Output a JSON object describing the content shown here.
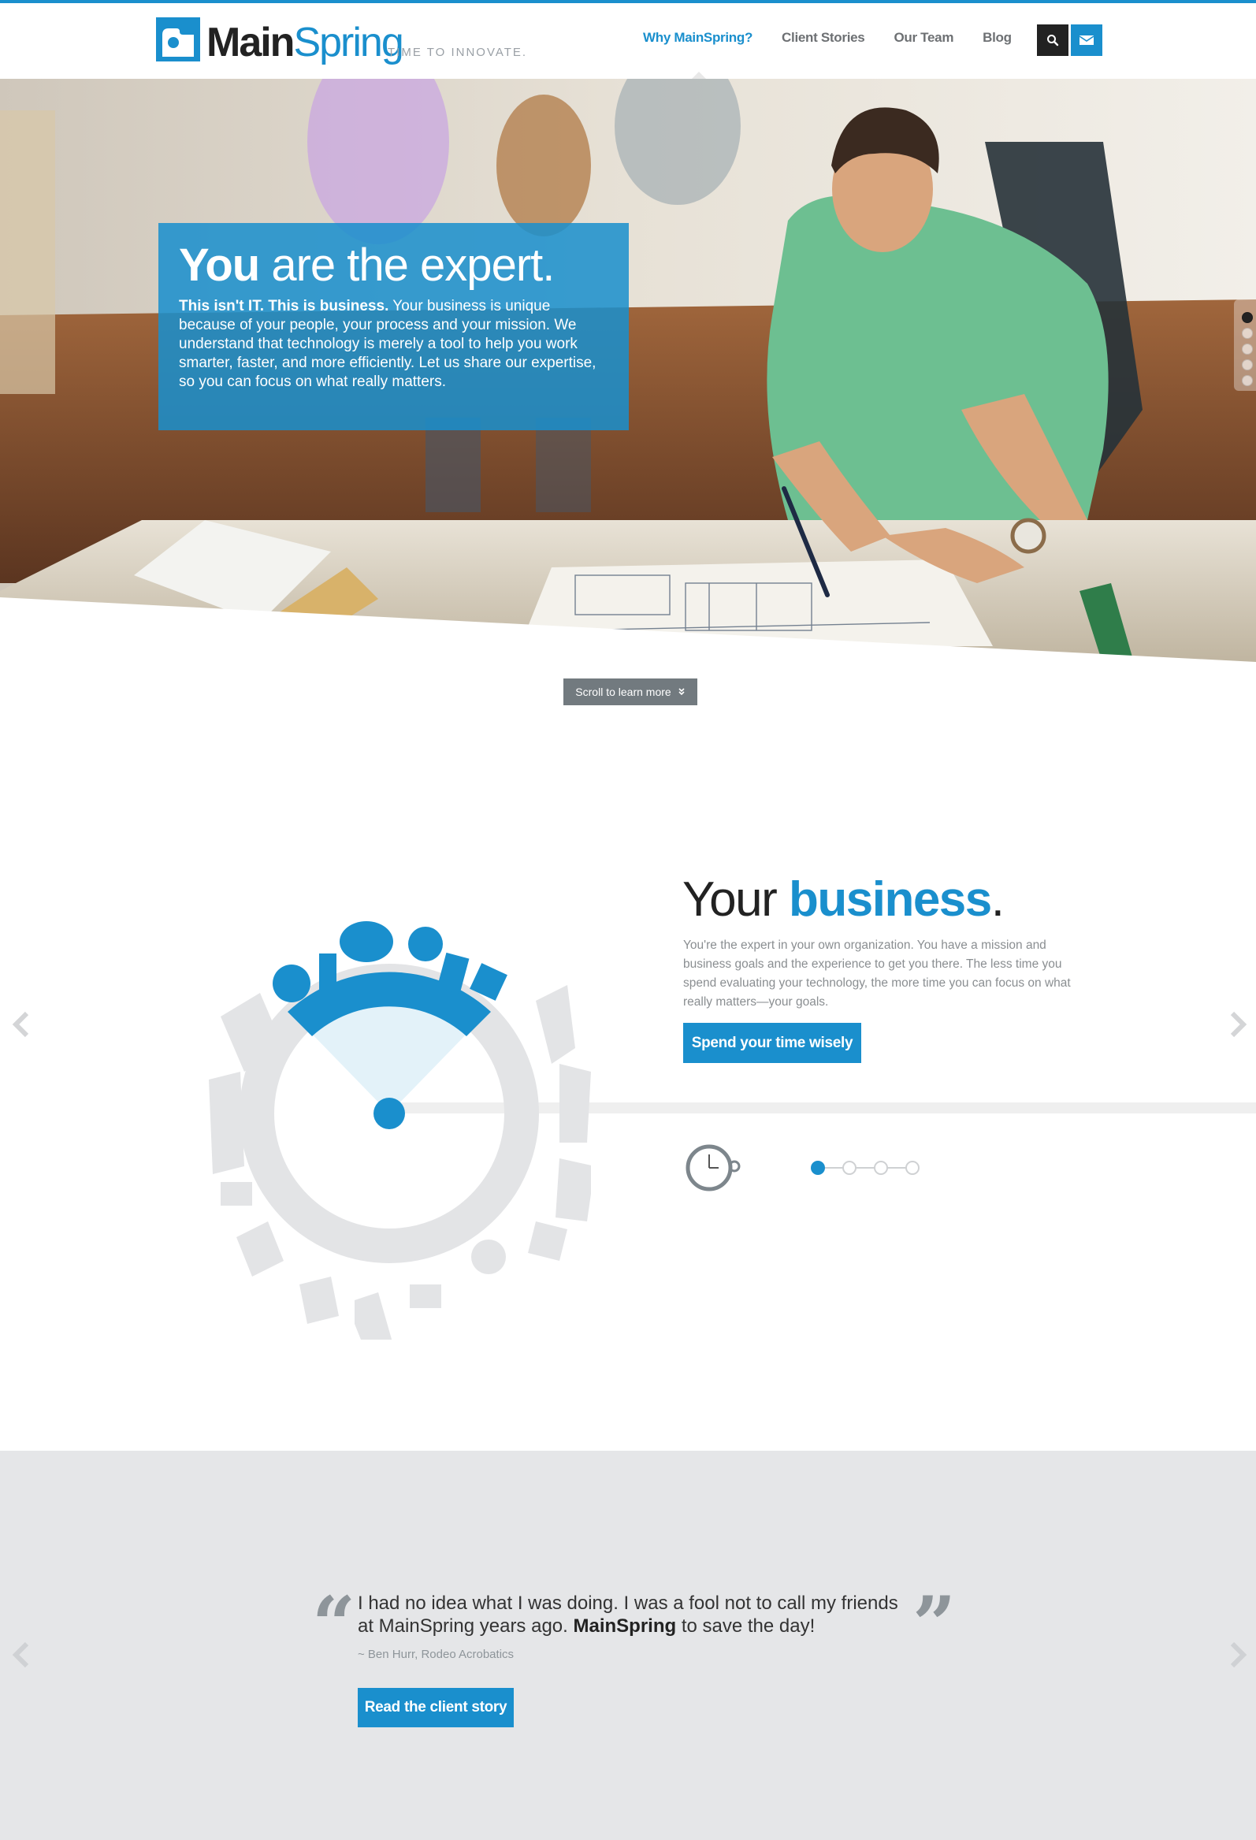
{
  "brand": {
    "logo_main": "Main",
    "logo_accent": "Spring",
    "tagline": "TIME TO INNOVATE.",
    "accent_color": "#1a8fcd"
  },
  "nav": {
    "items": [
      {
        "label": "Why MainSpring?",
        "active": true
      },
      {
        "label": "Client Stories",
        "active": false
      },
      {
        "label": "Our Team",
        "active": false
      },
      {
        "label": "Blog",
        "active": false
      }
    ],
    "search_icon": "search-icon",
    "mail_icon": "mail-icon"
  },
  "hero": {
    "title_bold": "You",
    "title_rest": " are the expert.",
    "lead_bold": "This isn't IT. This is business.",
    "lead_rest": " Your business is unique because of your people, your process and your mission. We understand that technology is merely a tool to help you work smarter, faster, and more efficiently. Let us share our expertise, so you can focus on what really matters.",
    "slide_count": 5,
    "active_slide": 1
  },
  "scroll": {
    "label": "Scroll to learn more"
  },
  "business": {
    "title_pre": "Your ",
    "title_accent": "business",
    "title_post": ".",
    "body": "You're the expert in your own organization. You have a mission and business goals and the experience to get you there. The less time you spend evaluating your technology, the more time you can focus on what really matters—your goals.",
    "button": "Spend your time wisely",
    "step_count": 4,
    "active_step": 1
  },
  "testimonial": {
    "quote_pre": "I had no idea what I was doing. I was a fool not to call my friends at MainSpring years ago. ",
    "quote_bold": "MainSpring",
    "quote_post": " to save the day!",
    "author": "~ Ben Hurr, Rodeo Acrobatics",
    "button": "Read the client story"
  }
}
